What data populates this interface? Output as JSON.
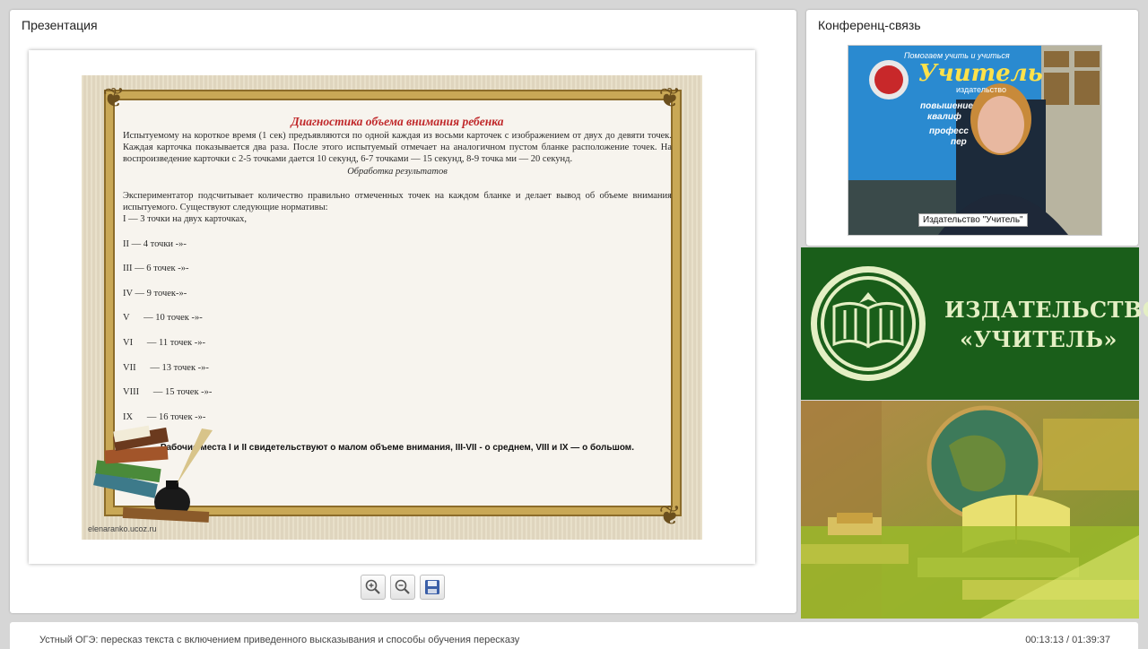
{
  "presentation_panel": {
    "title": "Презентация",
    "slide": {
      "heading": "Диагностика объема внимания ребенка",
      "paragraph1": "Испытуемому на короткое время (1 сек) предъявляются по одной каждая из восьми карточек с изображением от двух до девяти точек. Каждая карточка показывается два раза. После этого испытуемый отмечает на аналогичном пустом бланке расположение точек. На воспроизведение карточки с 2-5 точками дается 10 секунд, 6-7 точками — 15 секунд, 8-9 точка ми — 20 секунд.",
      "subheading": "Обработка результатов",
      "paragraph2": "Экспериментатор подсчитывает количество правильно отмеченных точек на каждом бланке и делает вывод об объеме внимания испытуемого. Существуют следующие нормативы:",
      "norms": [
        "I — 3 точки на двух карточках,",
        "II — 4 точки -»-",
        "III — 6 точек -»-",
        "IV — 9 точек-»-",
        "V      — 10 точек -»-",
        "VI      — 11 точек -»-",
        "VII      — 13 точек -»-",
        "VIII      — 15 точек -»-",
        "IX      — 16 точек -»-"
      ],
      "conclusion": "Рабочие места I и II свидетельствуют о малом объеме внимания, III-VII - о среднем, VIII и IX — о большом.",
      "watermark": "elenaranko.ucoz.ru"
    },
    "toolbar": {
      "zoom_in_icon": "zoom-in-icon",
      "zoom_out_icon": "zoom-out-icon",
      "save_icon": "save-icon"
    }
  },
  "conference_panel": {
    "title": "Конференц-связь",
    "speaker_label": "Издательство \"Учитель\"",
    "poster": {
      "line1": "Помогаем учить и учиться",
      "brand": "Учитель",
      "sub": "издательство",
      "bullet1": "повышение",
      "bullet1b": "квалиф",
      "bullet2": "професс",
      "bullet2b": "пер"
    }
  },
  "publisher_banner": {
    "line1": "ИЗДАТЕЛЬСТВО",
    "line2": "«УЧИТЕЛЬ»",
    "logo_icon": "book-logo-icon"
  },
  "bottom_bar": {
    "course_title": "Устный ОГЭ: пересказ текста с включением приведенного высказывания и способы обучения пересказу",
    "time": "00:13:13 / 01:39:37"
  },
  "colors": {
    "background": "#d6d6d6",
    "slide_heading": "#c0282a",
    "publisher_green": "#1a5e1a",
    "publisher_text": "#e4efc4"
  }
}
